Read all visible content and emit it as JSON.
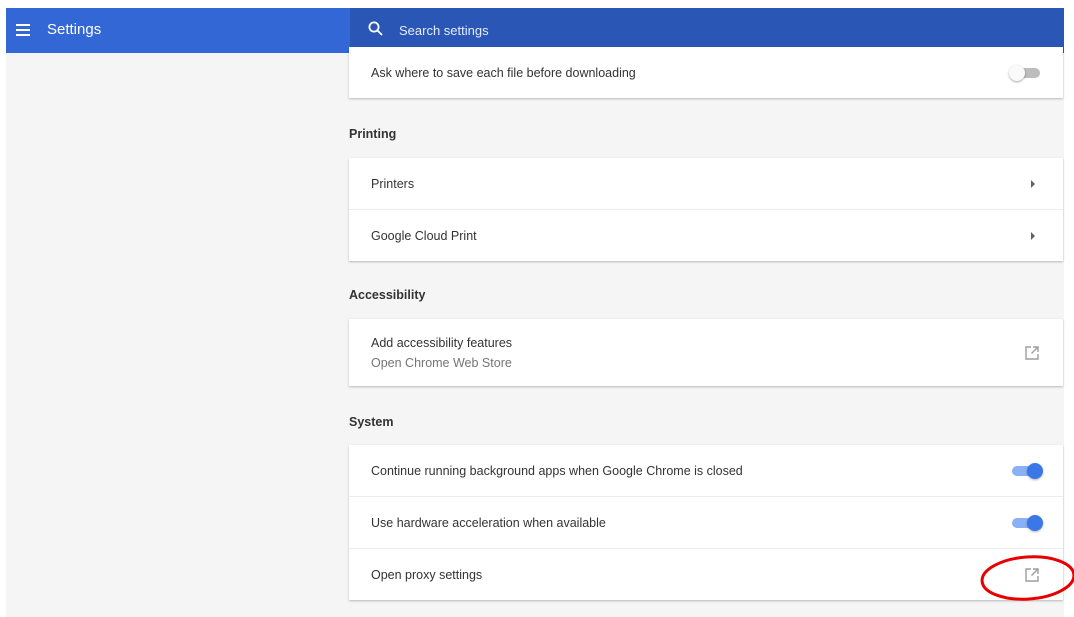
{
  "header": {
    "title": "Settings",
    "menu_icon": "hamburger-menu-icon",
    "search": {
      "placeholder": "Search settings",
      "value": "",
      "icon": "search-icon"
    },
    "color": "#3367d6"
  },
  "downloads": {
    "ask_where_label": "Ask where to save each file before downloading",
    "ask_where_enabled": false
  },
  "printing": {
    "title": "Printing",
    "items": [
      {
        "label": "Printers",
        "icon": "arrow-right-icon"
      },
      {
        "label": "Google Cloud Print",
        "icon": "arrow-right-icon"
      }
    ]
  },
  "accessibility": {
    "title": "Accessibility",
    "add_features_label": "Add accessibility features",
    "add_features_sub": "Open Chrome Web Store",
    "icon": "open-external-icon"
  },
  "system": {
    "title": "System",
    "background_apps_label": "Continue running background apps when Google Chrome is closed",
    "background_apps_enabled": true,
    "hardware_accel_label": "Use hardware acceleration when available",
    "hardware_accel_enabled": true,
    "proxy_label": "Open proxy settings",
    "proxy_icon": "open-external-icon"
  },
  "colors": {
    "accent": "#3b78e7",
    "annotation": "#e60000"
  }
}
